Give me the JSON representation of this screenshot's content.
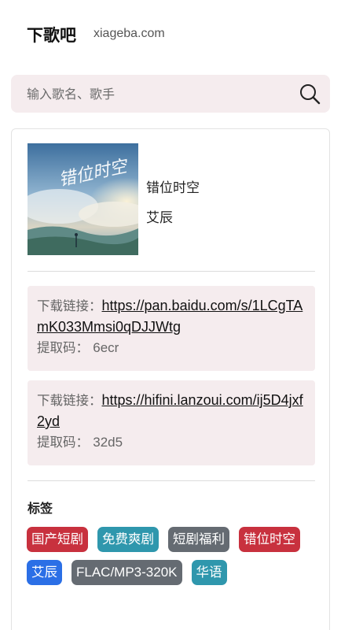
{
  "header": {
    "site_name": "下歌吧",
    "site_domain": "xiageba.com"
  },
  "search": {
    "placeholder": "输入歌名、歌手",
    "icon": "search-icon"
  },
  "song": {
    "title": "错位时空",
    "artist": "艾辰",
    "cover_text": "错位时空"
  },
  "downloads": [
    {
      "label": "下载链接：",
      "url": "https://pan.baidu.com/s/1LCgTAmK033Mmsi0qDJJWtg",
      "code_label": "提取码：",
      "code": "6ecr"
    },
    {
      "label": "下载链接：",
      "url": "https://hifini.lanzoui.com/ij5D4jxf2yd",
      "code_label": "提取码：",
      "code": "32d5"
    }
  ],
  "tags_heading": "标签",
  "tags": [
    {
      "label": "国产短剧",
      "color": "#c8313e"
    },
    {
      "label": "免费爽剧",
      "color": "#2f97ad"
    },
    {
      "label": "短剧福利",
      "color": "#656b72"
    },
    {
      "label": "错位时空",
      "color": "#c8313e"
    },
    {
      "label": "艾辰",
      "color": "#2b6fe6"
    },
    {
      "label": "FLAC/MP3-320K",
      "color": "#656b72"
    },
    {
      "label": "华语",
      "color": "#2f97ad"
    }
  ]
}
